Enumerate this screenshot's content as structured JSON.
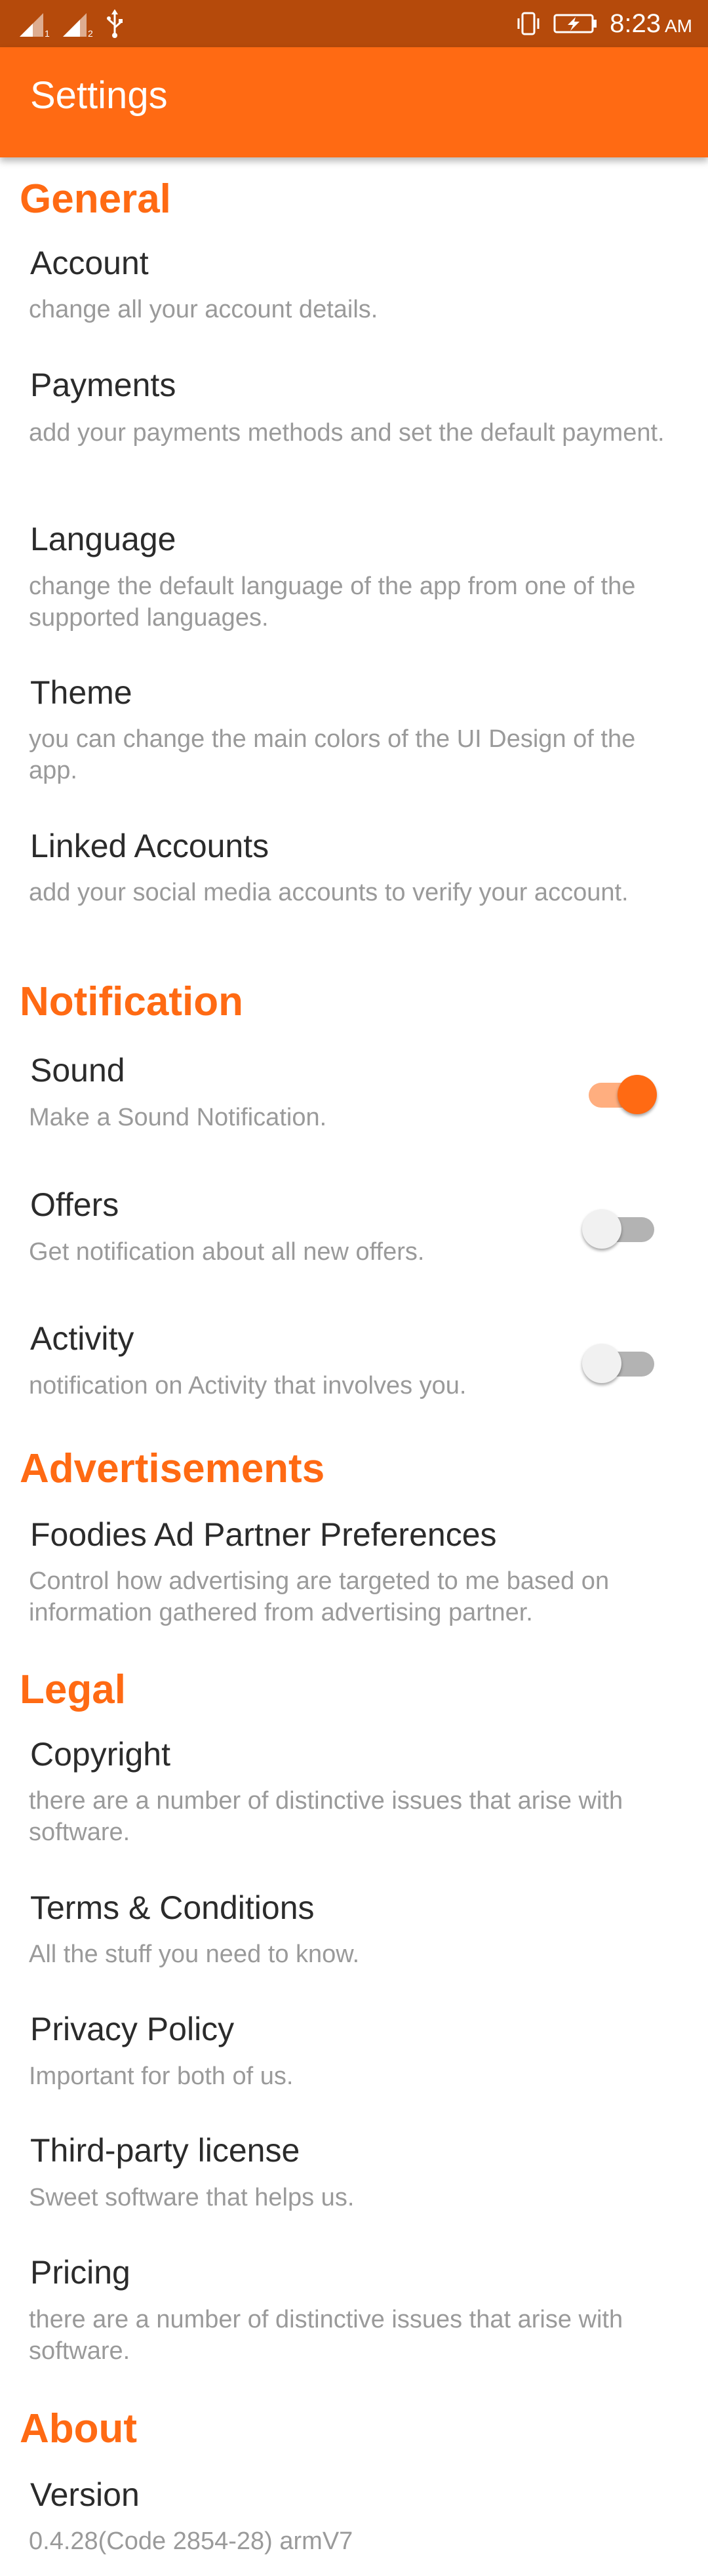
{
  "status_bar": {
    "time": "8:23",
    "ampm": "AM",
    "icons": [
      "signal-icon-1",
      "signal-icon-2",
      "usb-icon",
      "vibrate-icon",
      "battery-charging-icon"
    ]
  },
  "app_bar": {
    "title": "Settings"
  },
  "colors": {
    "accent": "#ff6a13",
    "status_bar": "#b54a0b",
    "subtitle": "#9a9a9a"
  },
  "sections": {
    "general": {
      "header": "General",
      "account": {
        "title": "Account",
        "subtitle": "change all your account details."
      },
      "payments": {
        "title": "Payments",
        "subtitle": "add your payments methods and set the  default payment."
      },
      "language": {
        "title": "Language",
        "subtitle": "change the default language of the app from one of the supported languages."
      },
      "theme": {
        "title": "Theme",
        "subtitle": "you can change the main colors of the UI Design of the app."
      },
      "linked": {
        "title": "Linked Accounts",
        "subtitle": "add your social media accounts to verify your account."
      }
    },
    "notification": {
      "header": "Notification",
      "sound": {
        "title": "Sound",
        "subtitle": "Make a Sound Notification.",
        "enabled": true
      },
      "offers": {
        "title": "Offers",
        "subtitle": "Get notification about all new offers.",
        "enabled": false
      },
      "activity": {
        "title": "Activity",
        "subtitle": "notification on Activity that involves you.",
        "enabled": false
      }
    },
    "advertisements": {
      "header": "Advertisements",
      "partner": {
        "title": "Foodies Ad Partner Preferences",
        "subtitle": "Control how advertising are targeted to me based on information gathered from advertising partner."
      }
    },
    "legal": {
      "header": "Legal",
      "copyright": {
        "title": "Copyright",
        "subtitle": "there are a number of distinctive issues that arise with software."
      },
      "terms": {
        "title": "Terms & Conditions",
        "subtitle": "All the stuff you need to know."
      },
      "privacy": {
        "title": "Privacy Policy",
        "subtitle": "Important for both of us."
      },
      "third_party": {
        "title": "Third-party license",
        "subtitle": "Sweet software that helps us."
      },
      "pricing": {
        "title": "Pricing",
        "subtitle": "there are a number of distinctive issues that arise with software."
      }
    },
    "about": {
      "header": "About",
      "version": {
        "title": "Version",
        "subtitle": "0.4.28(Code 2854-28) armV7"
      }
    }
  }
}
